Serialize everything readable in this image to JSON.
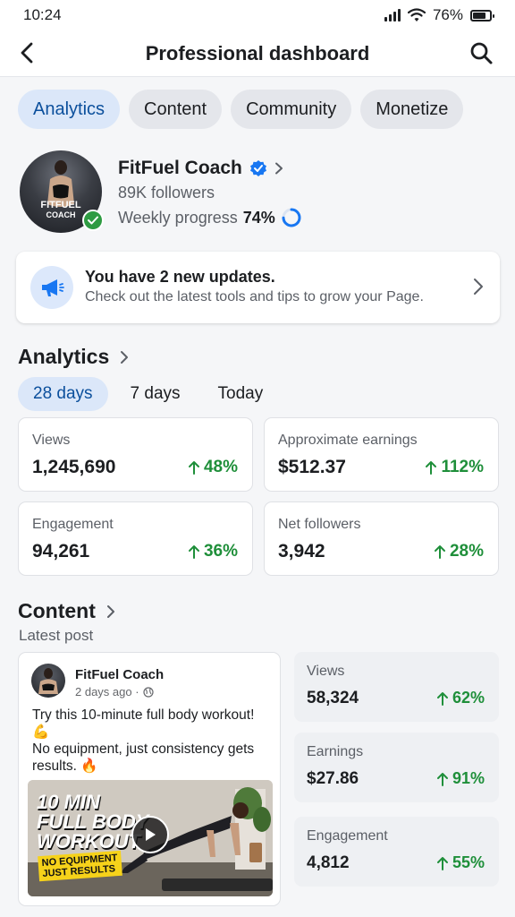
{
  "status_bar": {
    "time": "10:24",
    "battery": "76%",
    "battery_level": 0.76
  },
  "header": {
    "title": "Professional dashboard"
  },
  "tabs": [
    {
      "label": "Analytics",
      "active": true
    },
    {
      "label": "Content",
      "active": false
    },
    {
      "label": "Community",
      "active": false
    },
    {
      "label": "Monetize",
      "active": false
    }
  ],
  "profile": {
    "name": "FitFuel Coach",
    "followers": "89K followers",
    "progress_label": "Weekly progress",
    "progress_value": "74%",
    "progress_fraction": 0.74,
    "avatar_text_1": "FITFUEL",
    "avatar_text_2": "COACH"
  },
  "updates": {
    "title": "You have 2 new updates.",
    "subtitle": "Check out the latest tools and tips to grow your Page."
  },
  "analytics": {
    "title": "Analytics",
    "periods": [
      {
        "label": "28 days",
        "active": true
      },
      {
        "label": "7 days",
        "active": false
      },
      {
        "label": "Today",
        "active": false
      }
    ],
    "metrics": [
      {
        "label": "Views",
        "value": "1,245,690",
        "change": "48%"
      },
      {
        "label": "Approximate earnings",
        "value": "$512.37",
        "change": "112%"
      },
      {
        "label": "Engagement",
        "value": "94,261",
        "change": "36%"
      },
      {
        "label": "Net followers",
        "value": "3,942",
        "change": "28%"
      }
    ]
  },
  "content": {
    "title": "Content",
    "latest_label": "Latest post",
    "post": {
      "author": "FitFuel Coach",
      "time": "2 days ago ·",
      "text_1": "Try this 10-minute full body workout! 💪",
      "text_2": "No equipment, just consistency gets results. 🔥",
      "media_title_1": "10 MIN",
      "media_title_2": "FULL BODY",
      "media_title_3": "WORKOUT",
      "media_tag_1": "NO EQUIPMENT",
      "media_tag_2": "JUST RESULTS"
    },
    "stats": [
      {
        "label": "Views",
        "value": "58,324",
        "change": "62%"
      },
      {
        "label": "Earnings",
        "value": "$27.86",
        "change": "91%"
      },
      {
        "label": "Engagement",
        "value": "4,812",
        "change": "55%"
      }
    ]
  },
  "colors": {
    "accent": "#0b4f9c",
    "positive": "#1f8f3a",
    "verified": "#1877f2"
  }
}
